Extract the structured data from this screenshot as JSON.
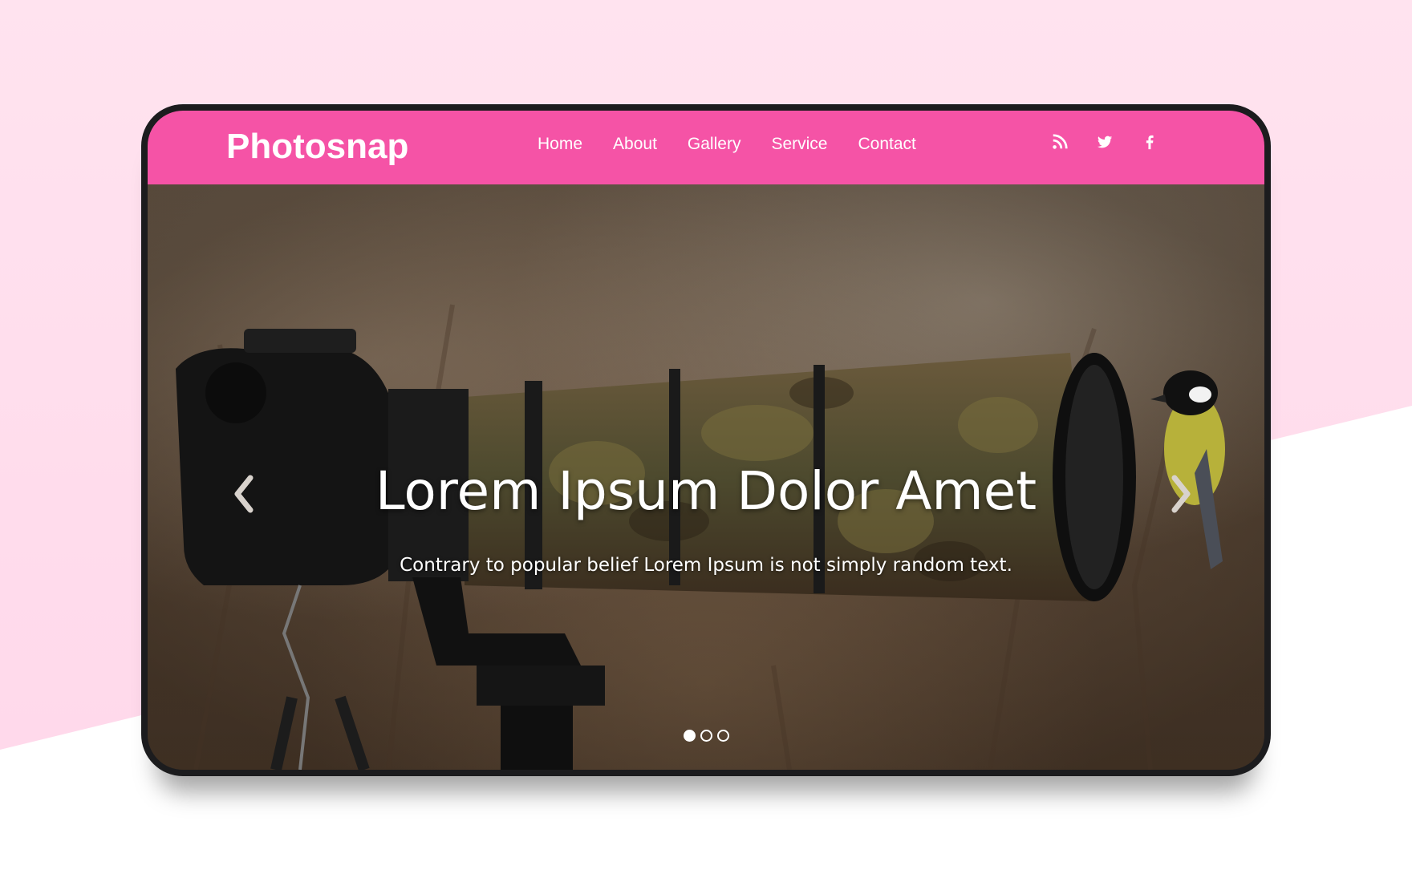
{
  "brand": {
    "name": "Photosnap"
  },
  "nav": {
    "items": [
      {
        "label": "Home"
      },
      {
        "label": "About"
      },
      {
        "label": "Gallery"
      },
      {
        "label": "Service"
      },
      {
        "label": "Contact"
      }
    ]
  },
  "social": {
    "icons": [
      "rss-icon",
      "twitter-icon",
      "facebook-icon"
    ]
  },
  "hero": {
    "title": "Lorem Ipsum Dolor Amet",
    "subtitle": "Contrary to popular belief Lorem Ipsum is not simply random text."
  },
  "carousel": {
    "slide_count": 3,
    "active_slide": 1
  },
  "colors": {
    "accent": "#f553a6",
    "background_pink": "#ffe3ef",
    "device_frame": "#1c1c1e"
  }
}
